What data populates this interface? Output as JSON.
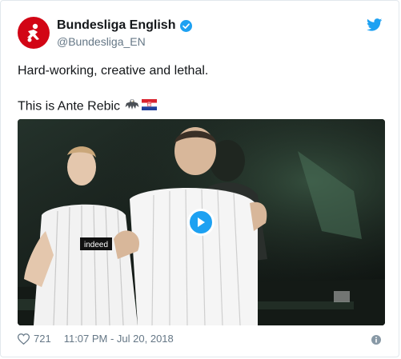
{
  "account": {
    "display_name": "Bundesliga English",
    "handle": "@Bundesliga_EN",
    "verified": true,
    "avatar_icon": "bundesliga-logo-icon",
    "brand_color": "#d20515"
  },
  "tweet": {
    "line1": "Hard-working, creative and lethal.",
    "line2": "This is Ante Rebic",
    "emojis": [
      "eagle-icon",
      "croatia-flag-icon"
    ]
  },
  "media": {
    "type": "video",
    "play_icon": "play-icon",
    "accent": "#1da1f2"
  },
  "footer": {
    "like_count": "721",
    "timestamp": "11:07 PM - Jul 20, 2018",
    "heart_icon": "heart-icon",
    "info_icon": "info-icon"
  },
  "colors": {
    "text": "#14171a",
    "muted": "#657786",
    "twitter_blue": "#1da1f2"
  }
}
